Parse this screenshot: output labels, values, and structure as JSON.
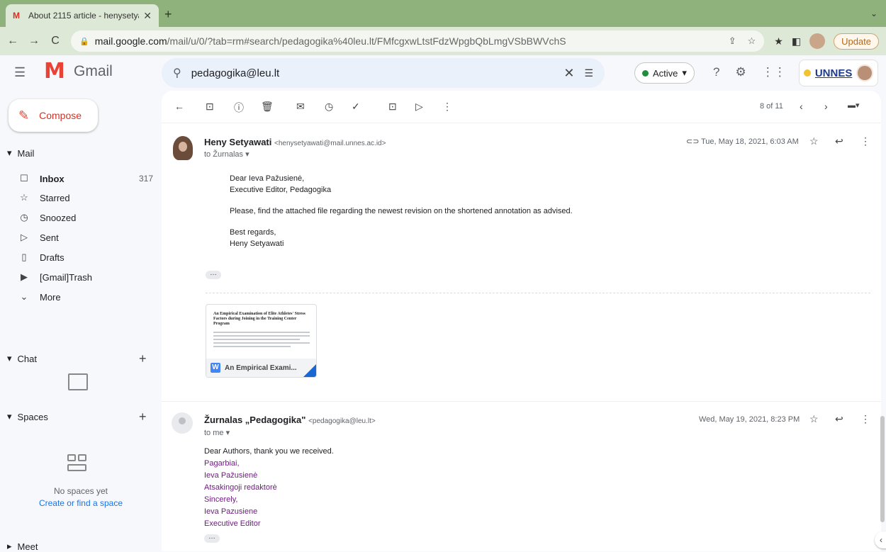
{
  "browser": {
    "tab_title": "About 2115 article - henysetya",
    "url_host": "mail.google.com",
    "url_path": "/mail/u/0/?tab=rm#search/pedagogika%40leu.lt/FMfcgxwLtstFdzWpgbQbLmgVSbBWVchS",
    "update_label": "Update"
  },
  "header": {
    "app_name": "Gmail",
    "search_value": "pedagogika@leu.lt",
    "status_label": "Active",
    "org_logo_text": "UNNES"
  },
  "sidebar": {
    "compose_label": "Compose",
    "mail_section": "Mail",
    "items": [
      {
        "label": "Inbox",
        "count": "317",
        "icon": "inbox-icon"
      },
      {
        "label": "Starred",
        "count": "",
        "icon": "star-icon"
      },
      {
        "label": "Snoozed",
        "count": "",
        "icon": "clock-icon"
      },
      {
        "label": "Sent",
        "count": "",
        "icon": "send-icon"
      },
      {
        "label": "Drafts",
        "count": "",
        "icon": "draft-icon"
      },
      {
        "label": "[Gmail]Trash",
        "count": "",
        "icon": "label-icon"
      },
      {
        "label": "More",
        "count": "",
        "icon": "chevron-down-icon"
      }
    ],
    "chat_section": "Chat",
    "spaces_section": "Spaces",
    "no_spaces": "No spaces yet",
    "create_space": "Create or find a space",
    "meet_section": "Meet"
  },
  "toolbar": {
    "page_counter": "8 of 11"
  },
  "messages": [
    {
      "sender_name": "Heny Setyawati",
      "sender_email": "<henysetyawati@mail.unnes.ac.id>",
      "recipient": "to Žurnalas",
      "date": "Tue, May 18, 2021, 6:03 AM",
      "body": [
        "Dear Ieva Pažusienė,",
        "Executive Editor, Pedagogika",
        "Please, find the attached file regarding the newest revision on the shortened annotation as advised.",
        "Best regards,",
        "Heny Setyawati"
      ],
      "attachment": {
        "doc_title": "An Empirical Examination of Elite Athletes' Stress Factors during Joining in the Training Center Program",
        "file_name": "An Empirical Exami..."
      }
    },
    {
      "sender_name": "Žurnalas „Pedagogika\"",
      "sender_email": "<pedagogika@leu.lt>",
      "recipient": "to me",
      "date": "Wed, May 19, 2021, 8:23 PM",
      "body": [
        "Dear Authors, thank you we received.",
        "Pagarbiai,",
        "Ieva Pažusienė",
        "Atsakingoji redaktorė",
        "Sincerely,",
        "Ieva Pazusiene",
        "Executive Editor"
      ]
    }
  ],
  "colors": {
    "accent": "#d93025",
    "link": "#1a73e8",
    "signature": "#6a1b7a",
    "active_status": "#1e8e3e"
  }
}
